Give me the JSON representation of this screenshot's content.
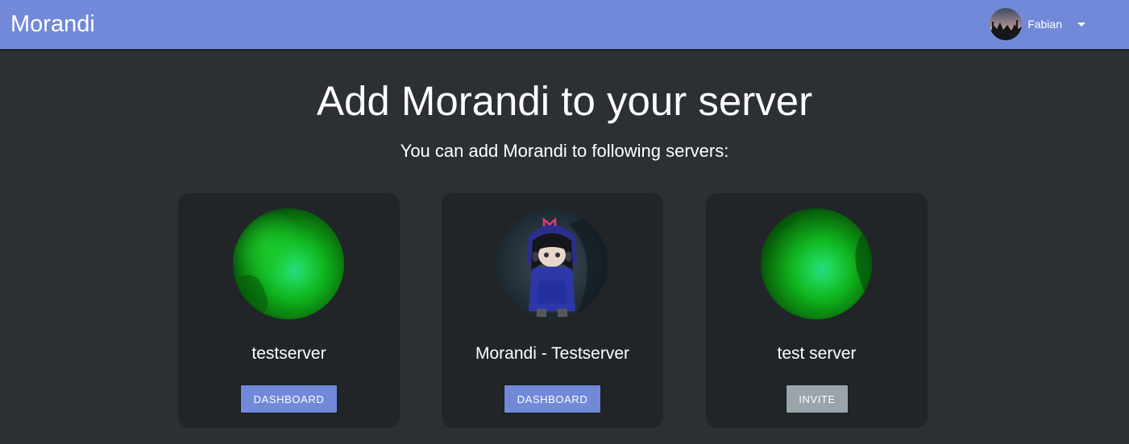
{
  "header": {
    "brand": "Morandi",
    "user": {
      "name": "Fabian",
      "avatar_icon": "user-avatar-landscape",
      "menu_icon": "caret-down-icon"
    }
  },
  "main": {
    "title": "Add Morandi to your server",
    "subtitle": "You can add Morandi to following servers:"
  },
  "servers": [
    {
      "name": "testserver",
      "icon": "green-gradient-server-icon",
      "button": "DASHBOARD",
      "button_color": "#7289da"
    },
    {
      "name": "Morandi - Testserver",
      "icon": "anime-character-server-icon",
      "button": "DASHBOARD",
      "button_color": "#7289da"
    },
    {
      "name": "test server",
      "icon": "green-gradient-server-icon",
      "button": "INVITE",
      "button_color": "#99a4ab"
    }
  ],
  "colors": {
    "navbar": "#7289da",
    "background": "#2c2f34",
    "card": "#222528",
    "button_primary": "#7289da",
    "button_secondary": "#99a4ab"
  }
}
